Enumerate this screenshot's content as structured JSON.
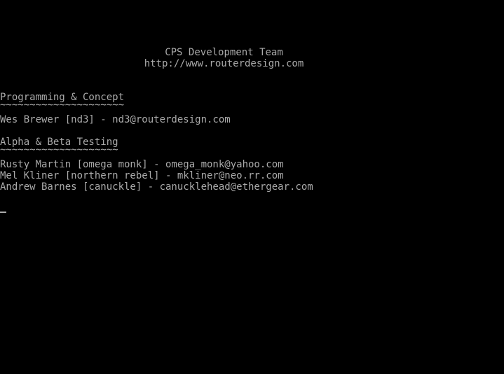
{
  "header": {
    "title": "CPS Development Team",
    "url": "http://www.routerdesign.com"
  },
  "sections": [
    {
      "heading": "Programming & Concept",
      "underline": "~~~~~~~~~~~~~~~~~~~~~",
      "entries": [
        "Wes Brewer [nd3] - nd3@routerdesign.com"
      ]
    },
    {
      "heading": "Alpha & Beta Testing",
      "underline": "~~~~~~~~~~~~~~~~~~~~",
      "entries": [
        "Rusty Martin [omega monk] - omega_monk@yahoo.com",
        "Mel Kliner [northern rebel] - mkliner@neo.rr.com",
        "Andrew Barnes [canuckle] - canucklehead@ethergear.com"
      ]
    }
  ],
  "colors": {
    "background": "#000000",
    "text": "#aaaaaa"
  }
}
